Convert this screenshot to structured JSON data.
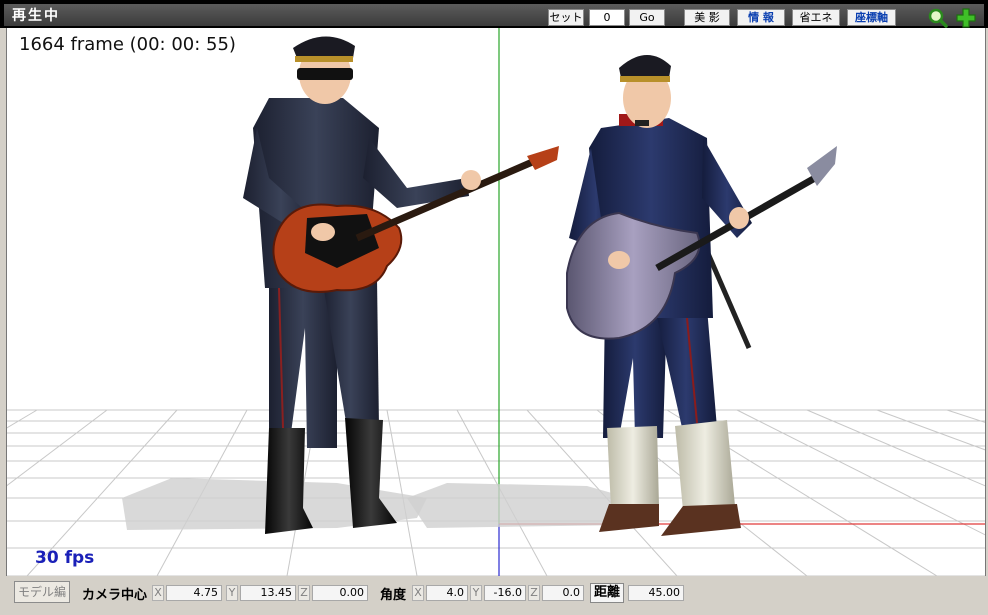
{
  "titlebar": {
    "title": "再生中",
    "set_label": "セット",
    "frame_value": "0",
    "go_label": "Go",
    "bieffect_label": "美 影",
    "info_label": "情 報",
    "eco_label": "省エネ",
    "axis_label": "座標軸",
    "icons": [
      "zoom-icon",
      "move-icon"
    ]
  },
  "viewport": {
    "frame_info": "1664 frame (00: 00: 55)",
    "fps": "30 fps"
  },
  "bottombar": {
    "model_edit_label": "モデル編",
    "camera_center_label": "カメラ中心",
    "camera_x_axis": "X",
    "camera_x": "4.75",
    "camera_y_axis": "Y",
    "camera_y": "13.45",
    "camera_z_axis": "Z",
    "camera_z": "0.00",
    "angle_label": "角度",
    "angle_x_axis": "X",
    "angle_x": "4.0",
    "angle_y_axis": "Y",
    "angle_y": "-16.0",
    "angle_z_axis": "Z",
    "angle_z": "0.0",
    "distance_label": "距離",
    "distance": "45.00"
  },
  "colors": {
    "accent_blue": "#0a3fb0",
    "fps_blue": "#1a20b8",
    "axis_green": "#2aa52a",
    "axis_red": "#e03a3a",
    "axis_blue": "#2a2ad0"
  }
}
